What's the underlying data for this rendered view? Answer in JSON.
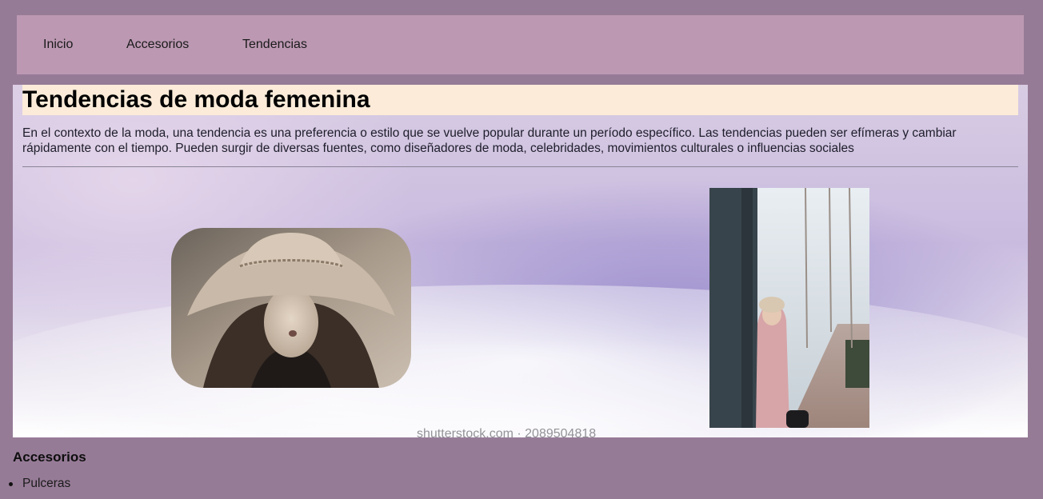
{
  "nav": {
    "items": [
      {
        "label": "Inicio"
      },
      {
        "label": "Accesorios"
      },
      {
        "label": "Tendencias"
      }
    ]
  },
  "main": {
    "title": "Tendencias de moda femenina",
    "intro": "En el contexto de la moda, una tendencia es una preferencia o estilo que se vuelve popular durante un período específico. Las tendencias pueden ser efímeras y cambiar rápidamente con el tiempo. Pueden surgir de diversas fuentes, como diseñadores de moda, celebridades, movimientos culturales o influencias sociales",
    "watermark": "shutterstock.com · 2089504818"
  },
  "accessories": {
    "heading": "Accesorios",
    "items": [
      "Pulceras"
    ]
  },
  "colors": {
    "page_background": "#967b97",
    "nav_background": "#bc98b2",
    "title_background": "#fbebd8"
  }
}
